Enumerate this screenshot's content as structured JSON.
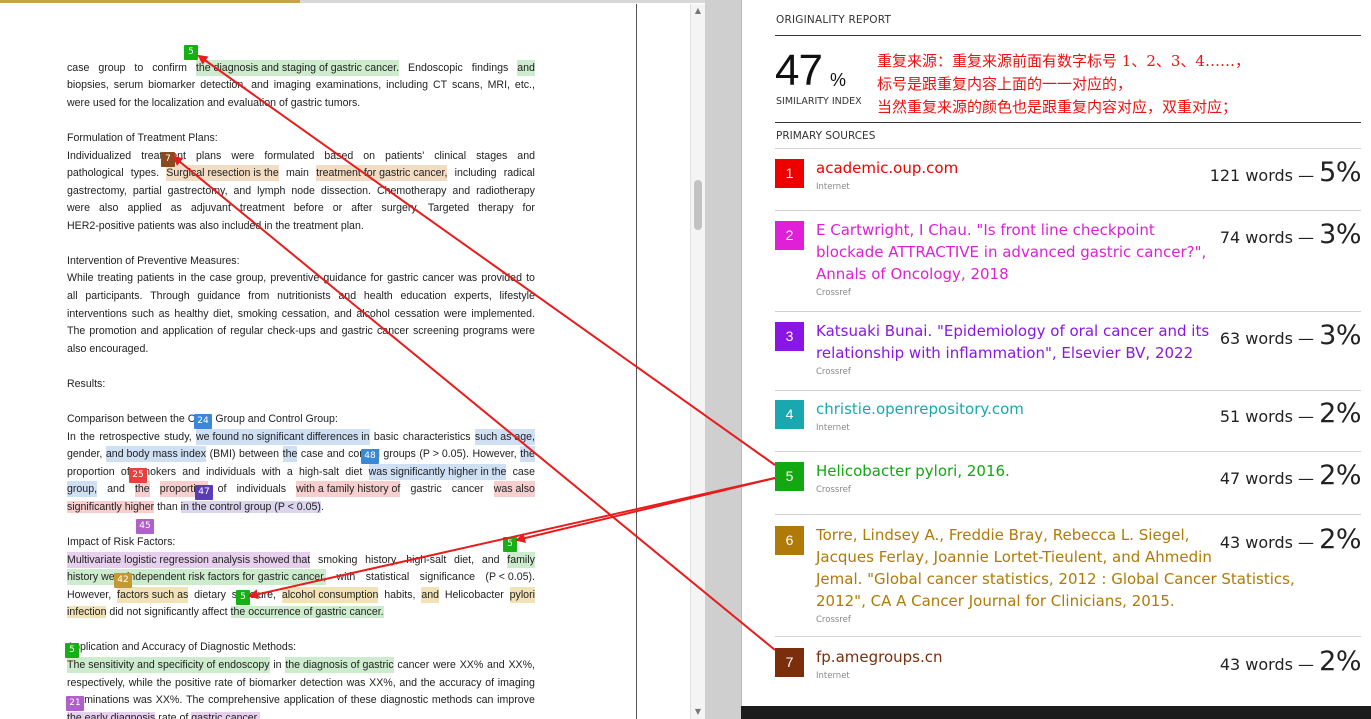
{
  "document": {
    "lines": [
      [
        "case group to confirm the diagnosis and staging of gastric cancer. Endoscopic findings and"
      ],
      [
        "biopsies, serum biomarker detection, and imaging examinations, including CT scans, MRI, etc.,"
      ],
      [
        "were used for the localization and evaluation of gastric tumors."
      ],
      [
        "Formulation of Treatment Plans:"
      ],
      [
        "Individualized treatment plans were formulated based on patients' clinical stages and"
      ],
      [
        "pathological types. Surgical resection is the main treatment for gastric cancer, including radical"
      ],
      [
        "gastrectomy, partial gastrectomy, and lymph node dissection. Chemotherapy and radiotherapy"
      ],
      [
        "were also applied as adjuvant treatment before or after surgery. Targeted therapy for"
      ],
      [
        "HER2-positive patients was also included in the treatment plan."
      ],
      [
        "Intervention of Preventive Measures:"
      ],
      [
        "While treating patients in the case group, preventive guidance for gastric cancer was provided to"
      ],
      [
        "all participants. Through guidance from nutritionists and health education experts, lifestyle"
      ],
      [
        "interventions such as healthy diet, smoking cessation, and alcohol cessation were implemented."
      ],
      [
        "The promotion and application of regular check-ups and gastric cancer screening programs were"
      ],
      [
        "also encouraged."
      ],
      [
        "Results:"
      ],
      [
        "Comparison between the Case Group and Control Group:"
      ],
      [
        "In the retrospective study, we found no significant differences in basic characteristics such as age,"
      ],
      [
        "gender, and body mass index (BMI) between the case and control groups (P > 0.05). However, the"
      ],
      [
        "proportion of smokers and individuals with a high-salt diet was significantly higher in the case"
      ],
      [
        "group, and the proportion of individuals with a family history of gastric cancer was also"
      ],
      [
        "significantly higher than in the control group (P < 0.05)."
      ],
      [
        "Impact of Risk Factors:"
      ],
      [
        "Multivariate logistic regression analysis showed that smoking history, high-salt diet, and family"
      ],
      [
        "history were independent risk factors for gastric cancer, with statistical significance (P < 0.05)."
      ],
      [
        "However, factors such as dietary structure, alcohol consumption habits, and Helicobacter pylori"
      ],
      [
        "infection did not significantly affect the occurrence of gastric cancer."
      ],
      [
        "Application and Accuracy of Diagnostic Methods:"
      ],
      [
        "The sensitivity and specificity of endoscopy in the diagnosis of gastric cancer were XX% and XX%,"
      ],
      [
        "respectively, while the positive rate of biomarker detection was XX%, and the accuracy of imaging"
      ],
      [
        "examinations was XX%. The comprehensive application of these diagnostic methods can improve"
      ],
      [
        "the early diagnosis rate of gastric cancer."
      ]
    ],
    "tags": [
      "5",
      "7",
      "24",
      "48",
      "25",
      "47",
      "45",
      "5",
      "42",
      "5",
      "5",
      "21"
    ]
  },
  "report": {
    "title": "ORIGINALITY REPORT",
    "similarity_value": "47",
    "similarity_unit": "%",
    "similarity_label": "SIMILARITY INDEX",
    "note_lines": [
      "重复来源：重复来源前面有数字标号 1、2、3、4……，",
      "标号是跟重复内容上面的一一对应的，",
      "当然重复来源的颜色也是跟重复内容对应，双重对应；"
    ],
    "primary_label": "PRIMARY SOURCES",
    "sources": [
      {
        "num": "1",
        "title_lines": [
          "academic.oup.com"
        ],
        "type": "Internet",
        "words": "121 words —",
        "percent": "5%",
        "color": "#ee0000"
      },
      {
        "num": "2",
        "title_lines": [
          "E Cartwright, I Chau. \"Is front line checkpoint",
          "blockade ATTRACTIVE in advanced gastric cancer?\",",
          "Annals of Oncology, 2018"
        ],
        "type": "Crossref",
        "words": "74 words —",
        "percent": "3%",
        "color": "#e020d6"
      },
      {
        "num": "3",
        "title_lines": [
          "Katsuaki Bunai. \"Epidemiology of oral cancer and its",
          "relationship with inflammation\", Elsevier BV, 2022"
        ],
        "type": "Crossref",
        "words": "63 words —",
        "percent": "3%",
        "color": "#8a16e6"
      },
      {
        "num": "4",
        "title_lines": [
          "christie.openrepository.com"
        ],
        "type": "Internet",
        "words": "51 words —",
        "percent": "2%",
        "color": "#1aa8b0"
      },
      {
        "num": "5",
        "title_lines": [
          "Helicobacter pylori, 2016."
        ],
        "type": "Crossref",
        "words": "47 words —",
        "percent": "2%",
        "color": "#12a812"
      },
      {
        "num": "6",
        "title_lines": [
          "Torre, Lindsey A., Freddie Bray, Rebecca L. Siegel,",
          "Jacques Ferlay, Joannie Lortet-Tieulent, and Ahmedin",
          "Jemal. \"Global cancer statistics, 2012 : Global Cancer Statistics,",
          "2012\", CA A Cancer Journal for Clinicians, 2015."
        ],
        "type": "Crossref",
        "words": "43 words —",
        "percent": "2%",
        "color": "#b07a08"
      },
      {
        "num": "7",
        "title_lines": [
          "fp.amegroups.cn"
        ],
        "type": "Internet",
        "words": "43 words —",
        "percent": "2%",
        "color": "#7a2e0c"
      }
    ]
  },
  "colors": {
    "arrow": "#e81c1c",
    "tag_green": "#14b014",
    "tag_brown": "#8a4b1e",
    "tag_blue": "#3a88d6",
    "tag_red": "#e8403c",
    "tag_indigo": "#5a3cb8",
    "tag_violet": "#b060c8",
    "tag_gold": "#c49a30"
  }
}
